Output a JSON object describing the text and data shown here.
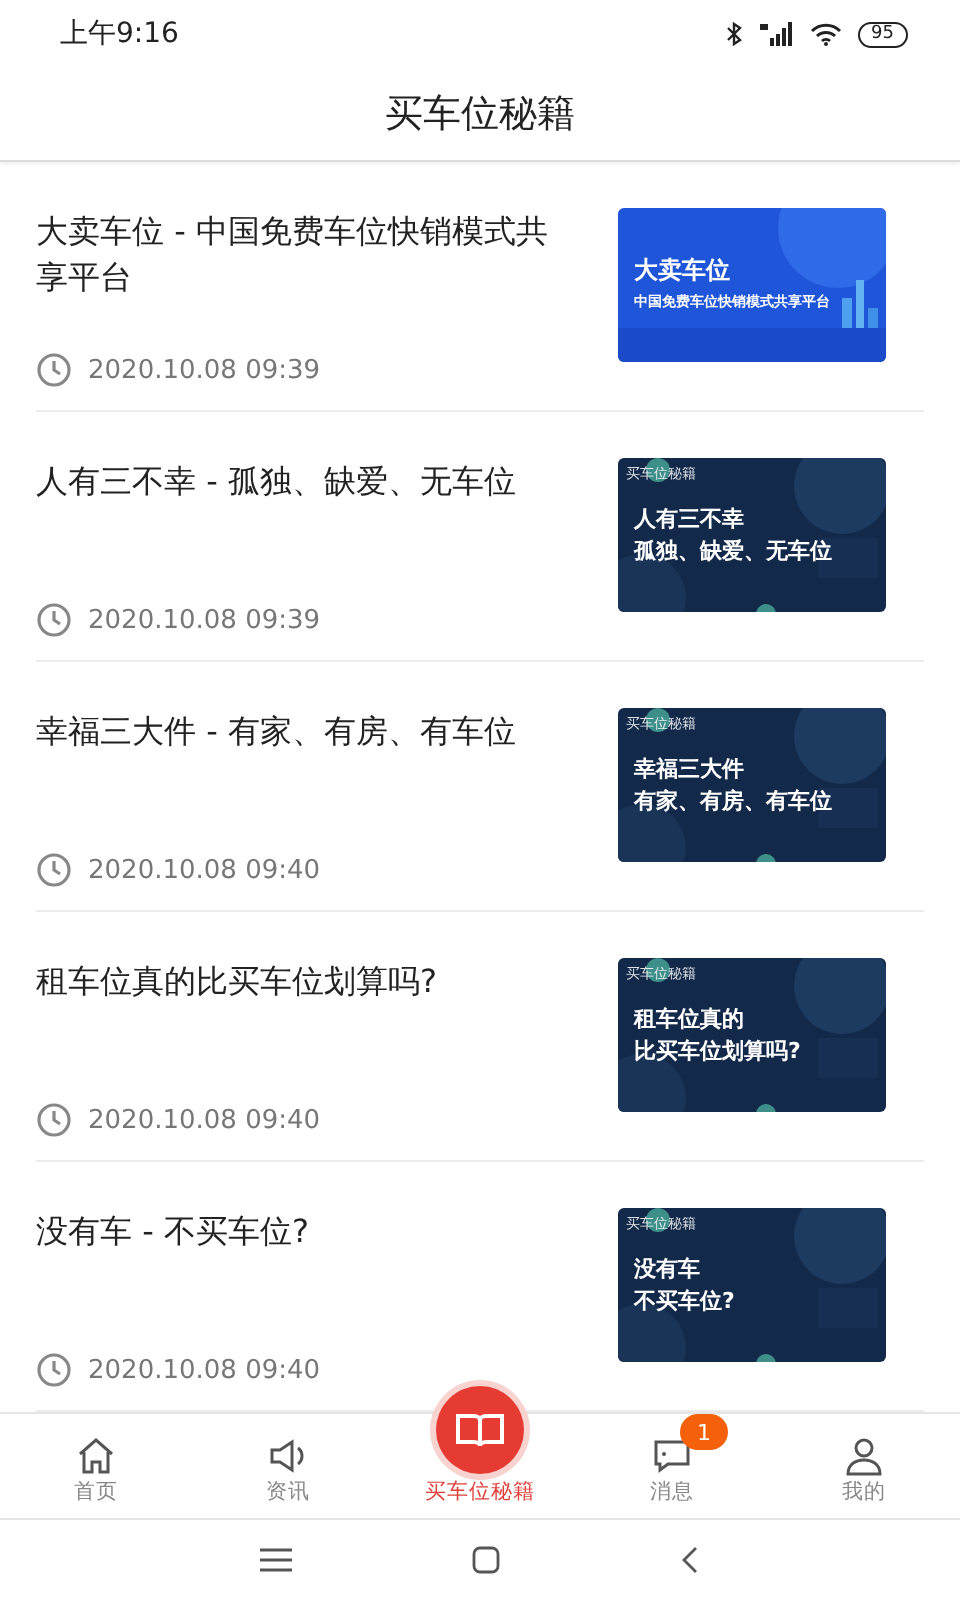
{
  "status_bar": {
    "time": "上午9:16",
    "battery": "95"
  },
  "header": {
    "title": "买车位秘籍"
  },
  "articles": [
    {
      "title": "大卖车位 - 中国免费车位快销模式共享平台",
      "date": "2020.10.08 09:39",
      "thumbnail": {
        "kind": "blue",
        "lines": [
          "大卖车位",
          "中国免费车位快销模式共享平台"
        ]
      }
    },
    {
      "title": "人有三不幸 - 孤独、缺爱、无车位",
      "date": "2020.10.08 09:39",
      "thumbnail": {
        "kind": "dark",
        "tag": "买车位秘籍",
        "lines": [
          "人有三不幸",
          "孤独、缺爱、无车位"
        ]
      }
    },
    {
      "title": "幸福三大件 - 有家、有房、有车位",
      "date": "2020.10.08 09:40",
      "thumbnail": {
        "kind": "dark",
        "tag": "买车位秘籍",
        "lines": [
          "幸福三大件",
          "有家、有房、有车位"
        ]
      }
    },
    {
      "title": "租车位真的比买车位划算吗?",
      "date": "2020.10.08 09:40",
      "thumbnail": {
        "kind": "dark",
        "tag": "买车位秘籍",
        "lines": [
          "租车位真的",
          "比买车位划算吗?"
        ]
      }
    },
    {
      "title": "没有车 - 不买车位?",
      "date": "2020.10.08 09:40",
      "thumbnail": {
        "kind": "dark",
        "tag": "买车位秘籍",
        "lines": [
          "没有车",
          "不买车位?"
        ]
      }
    }
  ],
  "tab_bar": [
    {
      "kind": "home",
      "label": "首页",
      "selected": false
    },
    {
      "kind": "speaker",
      "label": "资讯",
      "selected": false
    },
    {
      "kind": "book",
      "label": "买车位秘籍",
      "selected": true
    },
    {
      "kind": "chat",
      "label": "消息",
      "selected": false,
      "badge": "1"
    },
    {
      "kind": "person",
      "label": "我的",
      "selected": false
    }
  ]
}
